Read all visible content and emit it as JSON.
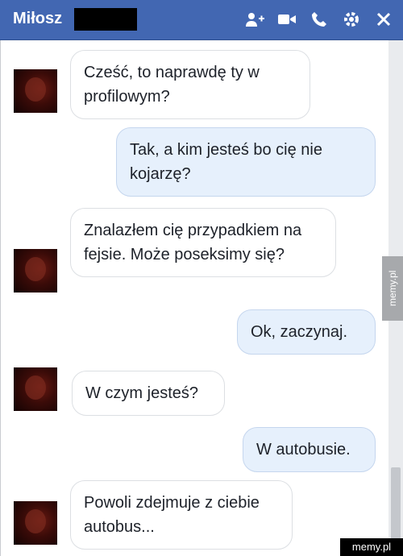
{
  "header": {
    "contact_name": "Miłosz",
    "icons": [
      "add-friend-icon",
      "video-call-icon",
      "phone-icon",
      "gear-icon",
      "close-icon"
    ]
  },
  "messages": [
    {
      "side": "in",
      "text": "Cześć, to naprawdę ty w profilowym?"
    },
    {
      "side": "out",
      "text": "Tak, a kim jesteś bo cię nie kojarzę?"
    },
    {
      "side": "in",
      "text": "Znalazłem cię przypadkiem na fejsie. Może poseksimy się?"
    },
    {
      "side": "out",
      "text": "Ok, zaczynaj."
    },
    {
      "side": "in",
      "text": "W czym jesteś?"
    },
    {
      "side": "out",
      "text": "W autobusie."
    },
    {
      "side": "in",
      "text": "Powoli zdejmuje z ciebie autobus..."
    }
  ],
  "watermark": {
    "side": "memy.pl",
    "corner": "memy.pl"
  },
  "colors": {
    "header": "#4267b2",
    "outgoing_bubble": "#e6f0fc",
    "incoming_bubble": "#ffffff"
  }
}
